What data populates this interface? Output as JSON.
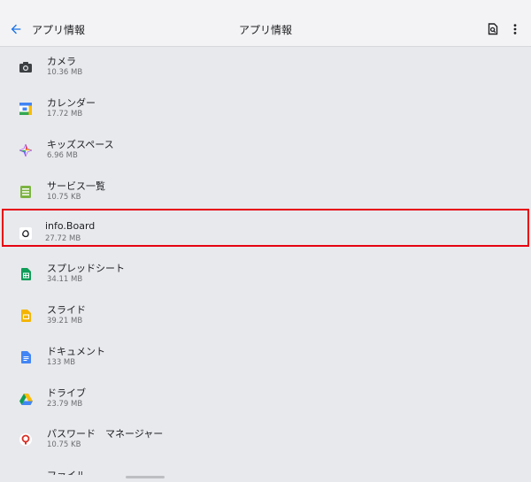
{
  "appbar": {
    "nav_title": "アプリ情報",
    "center_title": "アプリ情報"
  },
  "colors": {
    "accent": "#1a73e8",
    "highlight": "#e60012"
  },
  "apps": [
    {
      "name": "カメラ",
      "size": "10.36 MB",
      "icon": "camera-icon"
    },
    {
      "name": "カレンダー",
      "size": "17.72 MB",
      "icon": "calendar-icon"
    },
    {
      "name": "キッズスペース",
      "size": "6.96 MB",
      "icon": "kids-space-icon"
    },
    {
      "name": "サービス一覧",
      "size": "10.75 KB",
      "icon": "service-list-icon"
    },
    {
      "name": "info.Board",
      "size": "27.72 MB",
      "icon": "info-board-icon"
    },
    {
      "name": "スプレッドシート",
      "size": "34.11 MB",
      "icon": "sheets-icon"
    },
    {
      "name": "スライド",
      "size": "39.21 MB",
      "icon": "slides-icon"
    },
    {
      "name": "ドキュメント",
      "size": "133 MB",
      "icon": "docs-icon"
    },
    {
      "name": "ドライブ",
      "size": "23.79 MB",
      "icon": "drive-icon"
    },
    {
      "name": "パスワード　マネージャー",
      "size": "10.75 KB",
      "icon": "password-manager-icon"
    },
    {
      "name": "ファイル",
      "size": "",
      "icon": "files-icon"
    }
  ]
}
